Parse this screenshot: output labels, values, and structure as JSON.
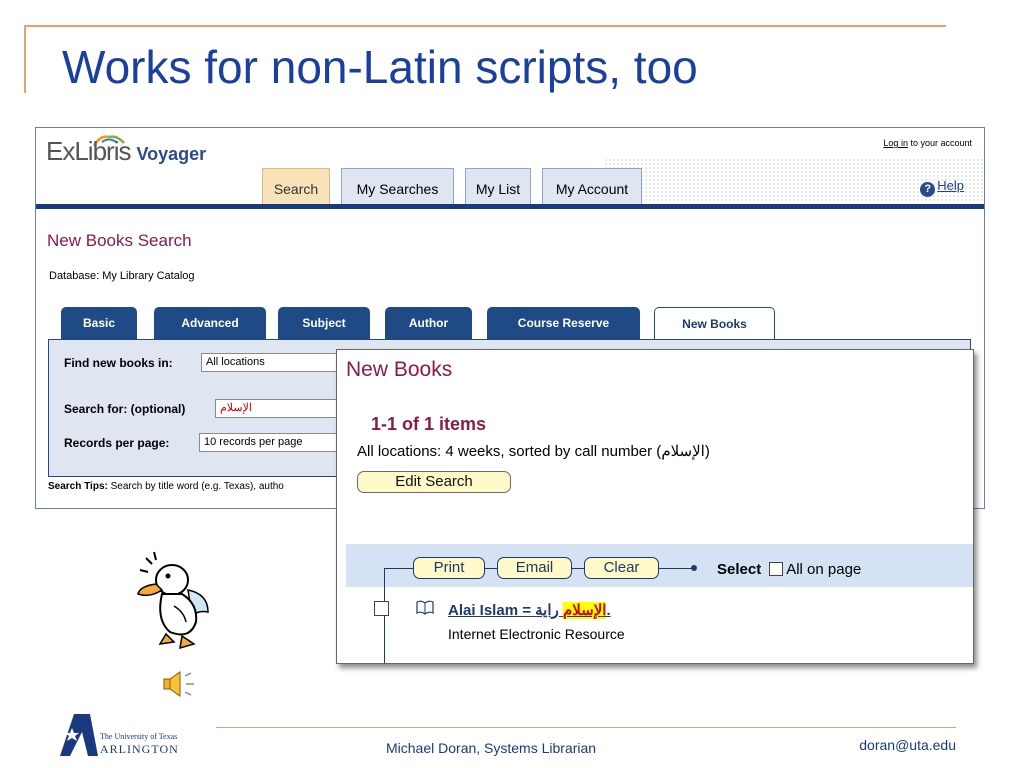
{
  "slide": {
    "title": "Works for non-Latin scripts, too",
    "footer": {
      "university_line1": "The University of Texas",
      "university_line2": "ARLINGTON",
      "center": "Michael Doran, Systems Librarian",
      "email": "doran@uta.edu"
    }
  },
  "app": {
    "logo": {
      "brand": "ExLibris",
      "product": "Voyager"
    },
    "login": {
      "link": "Log in",
      "suffix": " to your account"
    },
    "help": "Help",
    "top_tabs": [
      "Search",
      "My Searches",
      "My List",
      "My Account"
    ],
    "page_title": "New Books Search",
    "database": "Database: My Library Catalog",
    "search_tabs": [
      "Basic",
      "Advanced",
      "Subject",
      "Author",
      "Course Reserve",
      "New Books"
    ],
    "form": {
      "find_label": "Find new books in:",
      "find_value": "All locations",
      "search_label": "Search for: (optional)",
      "search_value": "الإسلام",
      "records_label": "Records per page:",
      "records_value": "10 records per page"
    },
    "search_tips_label": "Search Tips:",
    "search_tips_text": " Search by title word (e.g. Texas), autho"
  },
  "results": {
    "title": "New Books",
    "count": "1-1 of 1 items",
    "sort_text": "All locations: 4 weeks, sorted by call number (الإسلام)",
    "edit_button": "Edit Search",
    "actions": [
      "Print",
      "Email",
      "Clear"
    ],
    "select_label": "Select",
    "all_on_page": "All on page",
    "item": {
      "title_prefix": "Alai Islam = ",
      "title_highlight": "الإسلام",
      "title_suffix": " راية.",
      "resource_type": "Internet Electronic Resource"
    }
  },
  "icons": [
    "duck-clipart",
    "speaker-icon",
    "book-icon",
    "help-icon",
    "uta-star-logo"
  ],
  "colors": {
    "title_blue": "#1a3fa0",
    "accent_orange": "#e8a070",
    "voyager_navy": "#1f4a85",
    "maroon": "#8b1a4a",
    "highlight_yellow": "#ffff00"
  }
}
